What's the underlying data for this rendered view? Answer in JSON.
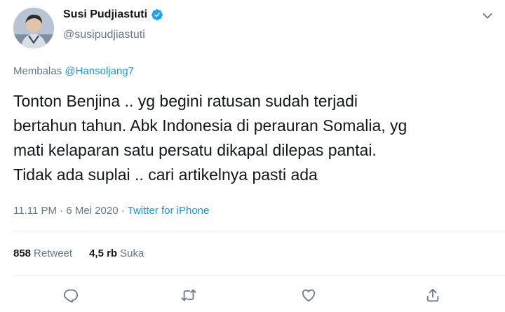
{
  "user": {
    "name": "Susi Pudjiastuti",
    "handle": "@susipudjiastuti",
    "avatar_icon": "profile-photo"
  },
  "reply": {
    "prefix": "Membalas",
    "mention": "@Hansoljang7"
  },
  "tweet": {
    "text": "Tonton Benjina .. yg begini ratusan sudah terjadi\nbertahun tahun. Abk Indonesia di perauran Somalia, yg\nmati kelaparan satu persatu dikapal dilepas pantai.\nTidak ada suplai .. cari artikelnya pasti ada"
  },
  "meta": {
    "time": "11.11 PM",
    "date": "6 Mei 2020",
    "dot1": "·",
    "dot2": "·",
    "source": "Twitter for iPhone"
  },
  "stats": {
    "retweet_count": "858",
    "retweet_label": "Retweet",
    "like_count": "4,5 rb",
    "like_label": "Suka"
  },
  "actions": [
    "reply-icon",
    "retweet-icon",
    "like-icon",
    "share-icon"
  ],
  "colors": {
    "link": "#1b95e0",
    "secondary": "#657786",
    "divider": "#e6ecf0"
  }
}
